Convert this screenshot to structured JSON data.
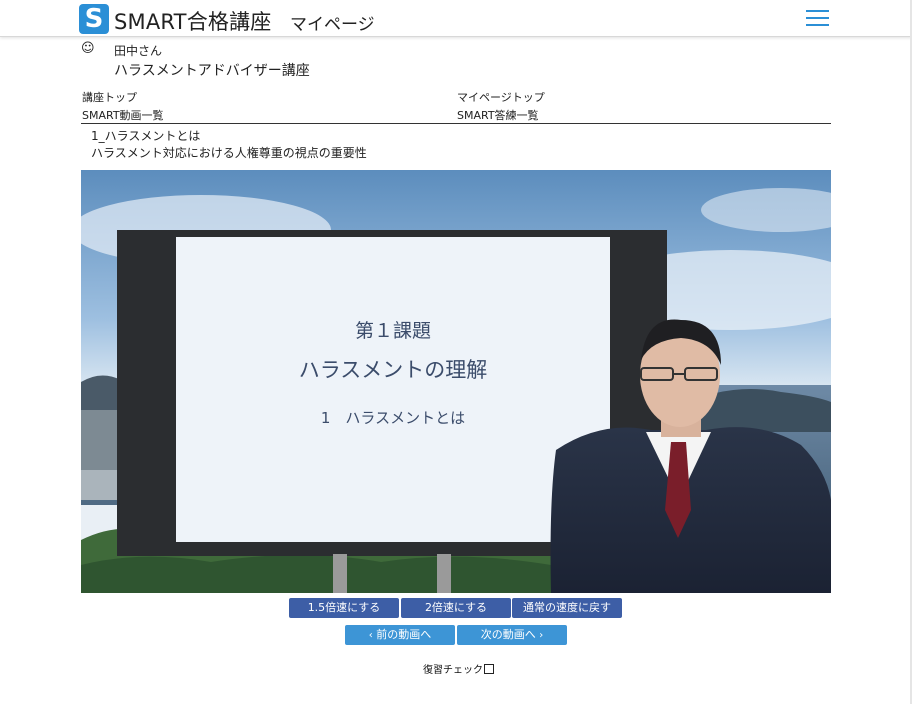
{
  "header": {
    "logo_letter": "S",
    "app_title": "SMART合格講座",
    "page_title": "マイページ",
    "menu_icon": "hamburger-icon",
    "brand_color": "#2b8fd6"
  },
  "user": {
    "icon": "smiley-icon",
    "icon_glyph": "☺",
    "name": "田中さん",
    "course": "ハラスメントアドバイザー講座"
  },
  "nav": {
    "course_top": "講座トップ",
    "mypage_top": "マイページトップ",
    "video_list": "SMART動画一覧",
    "answer_list": "SMART答練一覧"
  },
  "lesson": {
    "number_title": "1_ハラスメントとは",
    "title": "ハラスメント対応における人権尊重の視点の重要性"
  },
  "video": {
    "slide_heading": "第１課題",
    "slide_title": "ハラスメントの理解",
    "slide_item": "1　ハラスメントとは"
  },
  "controls": {
    "speed_15": "1.5倍速にする",
    "speed_2": "2倍速にする",
    "speed_normal": "通常の速度に戻す",
    "prev_label": "前の動画へ",
    "next_label": "次の動画へ",
    "prev_icon": "chevron-left-icon",
    "next_icon": "chevron-right-icon",
    "review_label": "復習チェック",
    "review_checked": false,
    "speed_color": "#3d5ea6",
    "nav_color": "#3d95d6"
  }
}
